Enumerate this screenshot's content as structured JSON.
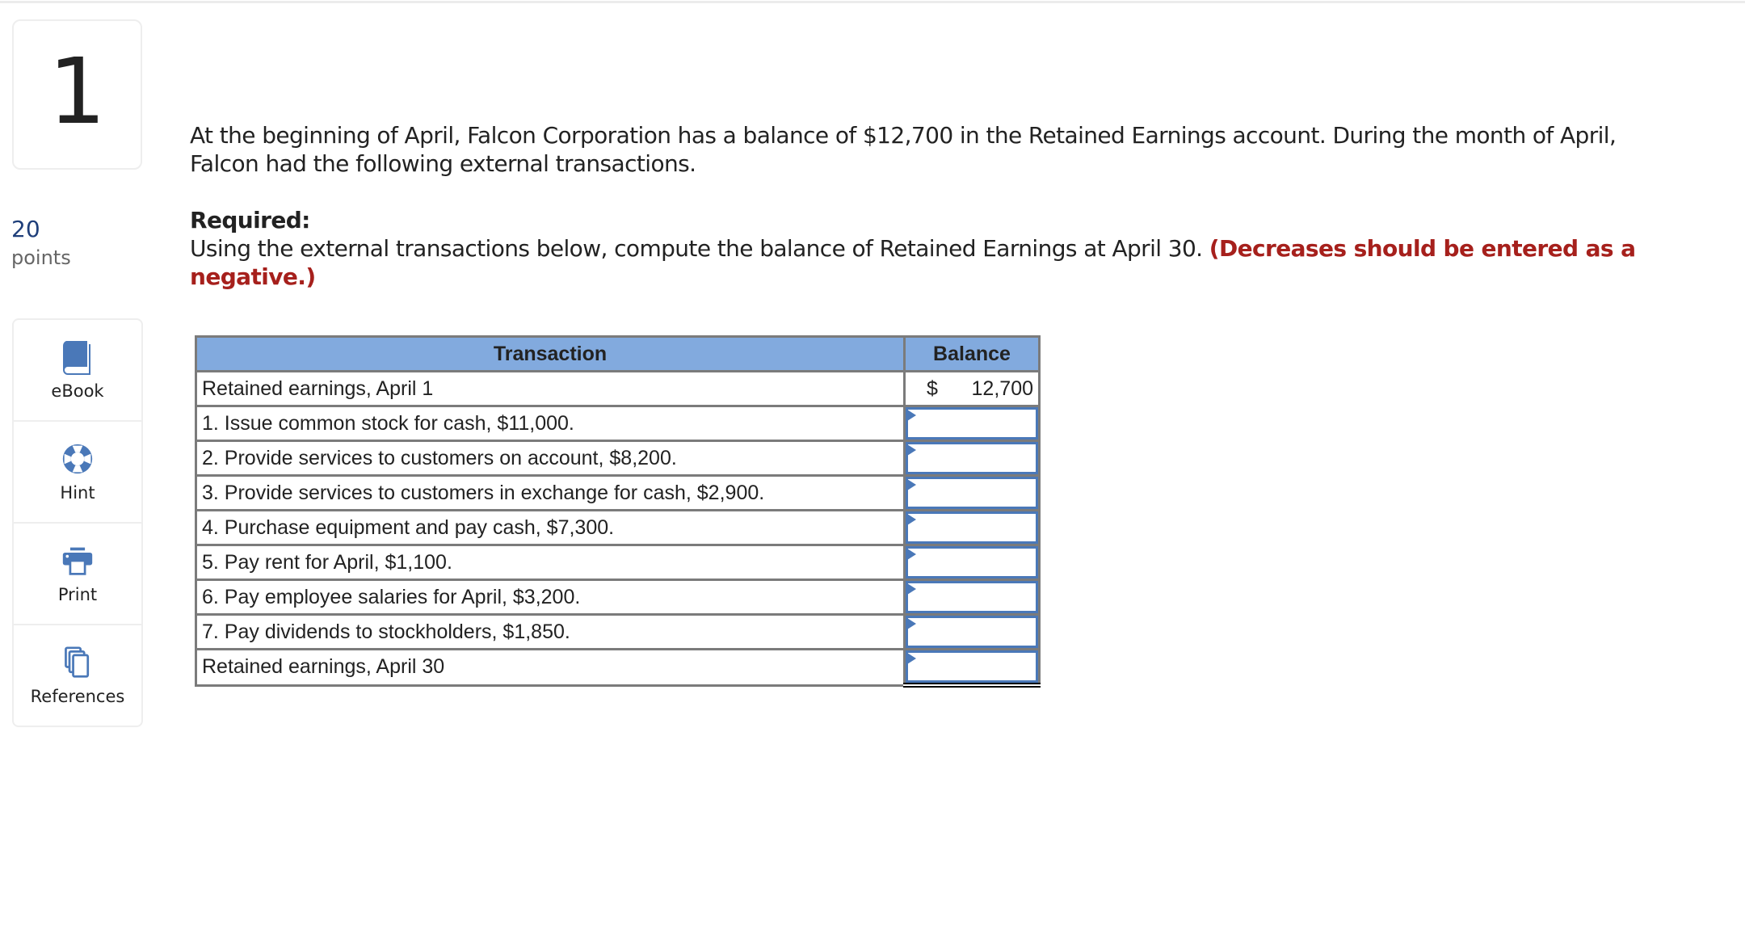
{
  "question": {
    "number": "1",
    "points_value": "20",
    "points_label": "points"
  },
  "tools": [
    {
      "label": "eBook",
      "icon": "book-icon"
    },
    {
      "label": "Hint",
      "icon": "lifebuoy-icon"
    },
    {
      "label": "Print",
      "icon": "printer-icon"
    },
    {
      "label": "References",
      "icon": "documents-icon"
    }
  ],
  "prompt": {
    "intro": "At the beginning of April, Falcon Corporation has a balance of $12,700 in the Retained Earnings account. During the month of April, Falcon had the following external transactions.",
    "required_label": "Required:",
    "instruction": "Using the external transactions below, compute the balance of Retained Earnings at April 30.",
    "note": "(Decreases should be entered as a negative.)"
  },
  "table": {
    "headers": {
      "transaction": "Transaction",
      "balance": "Balance"
    },
    "opening": {
      "label": "Retained earnings, April 1",
      "currency": "$",
      "value": "12,700"
    },
    "rows": [
      {
        "label": "1. Issue common stock for cash, $11,000.",
        "value": ""
      },
      {
        "label": "2. Provide services to customers on account, $8,200.",
        "value": ""
      },
      {
        "label": "3. Provide services to customers in exchange for cash, $2,900.",
        "value": ""
      },
      {
        "label": "4. Purchase equipment and pay cash, $7,300.",
        "value": ""
      },
      {
        "label": "5. Pay rent for April, $1,100.",
        "value": ""
      },
      {
        "label": "6. Pay employee salaries for April, $3,200.",
        "value": ""
      },
      {
        "label": "7. Pay dividends to stockholders, $1,850.",
        "value": ""
      }
    ],
    "closing": {
      "label": "Retained earnings, April 30",
      "value": ""
    }
  },
  "colors": {
    "accent": "#4a78b8",
    "header_bg": "#82aade",
    "warning": "#a6201c",
    "points": "#1f3f7a"
  }
}
